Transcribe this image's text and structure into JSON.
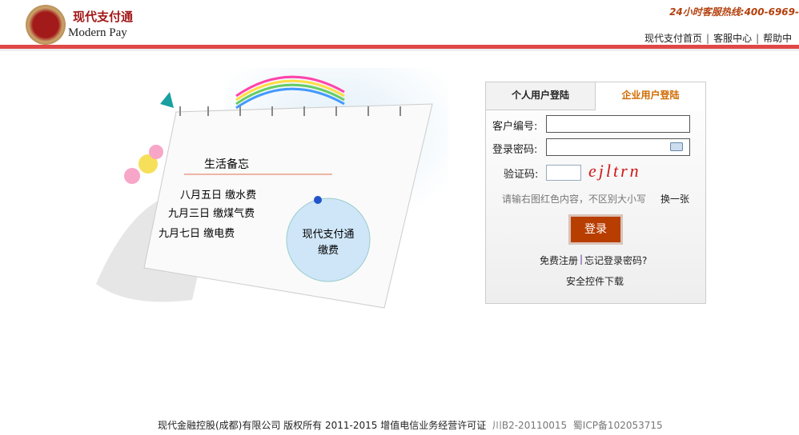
{
  "header": {
    "brand_cn": "现代支付通",
    "brand_en": "Modern Pay",
    "hotline": "24小时客服热线:400-6969-",
    "nav": [
      "现代支付首页",
      "客服中心",
      "帮助中"
    ]
  },
  "illustration": {
    "title": "生活备忘",
    "items": [
      "八月五日  缴水费",
      "九月三日  缴煤气费",
      "九月七日  缴电费"
    ],
    "badge": "现代支付通\n缴费"
  },
  "login": {
    "tabs": [
      "个人用户登陆",
      "企业用户登陆"
    ],
    "active_tab": 1,
    "customer_label": "客户编号:",
    "customer_value": "",
    "password_label": "登录密码:",
    "password_value": "",
    "keyboard_icon": "keyboard-icon",
    "captcha_label": "验证码:",
    "captcha_value": "",
    "captcha_text": "ejltrn",
    "hint": "请输右图红色内容，不区别大小写",
    "refresh": "换一张",
    "submit": "登录",
    "register": "免费注册",
    "forgot": "忘记登录密码?",
    "download": "安全控件下载"
  },
  "footer": {
    "company": "现代金融控股(成都)有限公司  版权所有  2011-2015 增值电信业务经营许可证",
    "license": "川B2-20110015",
    "icp": "蜀ICP备102053715"
  }
}
